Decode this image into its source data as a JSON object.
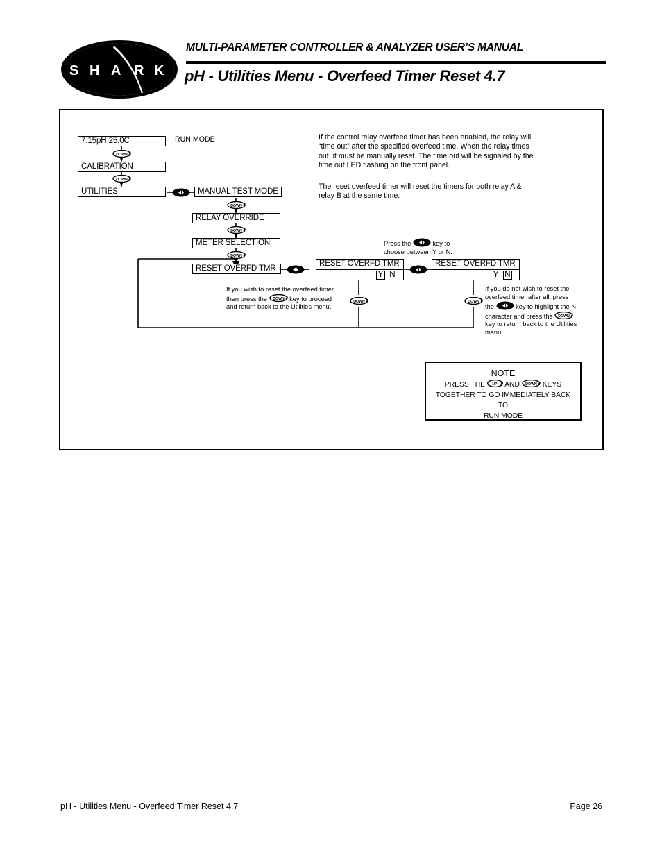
{
  "header": {
    "manual_title": "MULTI-PARAMETER CONTROLLER & ANALYZER USER’S MANUAL",
    "page_title": "pH - Utilities Menu - Overfeed Timer Reset 4.7",
    "logo_text": "S H A R K",
    "logo_letters": [
      "S",
      "H",
      "A",
      "R",
      "K"
    ]
  },
  "diagram": {
    "run_mode_label": "RUN MODE",
    "boxes": {
      "display": "7.15pH  25.0C",
      "calibration": "CALIBRATION",
      "utilities": "UTILITIES",
      "manual_test_mode": "MANUAL TEST MODE",
      "relay_override": "RELAY OVERRIDE",
      "meter_selection": "METER SELECTION",
      "reset_overfd_tmr": "RESET OVERFD TMR",
      "reset_overfd_tmr_y": "RESET OVERFD TMR",
      "reset_overfd_tmr_n": "RESET OVERFD TMR"
    },
    "yn": {
      "y": "Y",
      "n": "N",
      "left_box_selected": "Y",
      "right_box_selected": "N"
    },
    "keys": {
      "down": "DOWN",
      "up": "UP",
      "left_right": "left-right-arrow-key"
    }
  },
  "body_text": {
    "para1": "If the control relay overfeed timer has been enabled, the relay will “time out” after the specified overfeed time. When the relay times out, it must be manually reset. The time out will be signaled by the time out LED flashing on the front panel.",
    "para2": "The reset overfeed timer will reset the timers for both relay A & relay B at the same time."
  },
  "annotations": {
    "press_key_note_line1_a": "Press the",
    "press_key_note_line1_b": "key to",
    "press_key_note_line2": "choose between Y or N.",
    "yes_branch": {
      "line1": "If you wish to reset the overfeed timer,",
      "line2_a": "then press the",
      "line2_b": "key to  proceed",
      "line3": "and return back to the Utilities menu."
    },
    "no_branch": {
      "line1": "If you do not wish to reset the",
      "line2": "overfeed timer after all, press",
      "line3_a": "the",
      "line3_b": "key to highlight the N",
      "line4_a": "character and press the",
      "line5": "key to return back to the Utilities",
      "line6": "menu."
    }
  },
  "note": {
    "title": "NOTE",
    "line1_a": "PRESS THE",
    "line1_b": "AND",
    "line1_c": "KEYS",
    "line2": "TOGETHER TO GO IMMEDIATELY BACK TO",
    "line3": "RUN MODE"
  },
  "footer": {
    "left": "pH - Utilities Menu - Overfeed Timer Reset 4.7",
    "right": "Page 26"
  },
  "colors": {
    "ink": "#000000",
    "page": "#ffffff"
  }
}
